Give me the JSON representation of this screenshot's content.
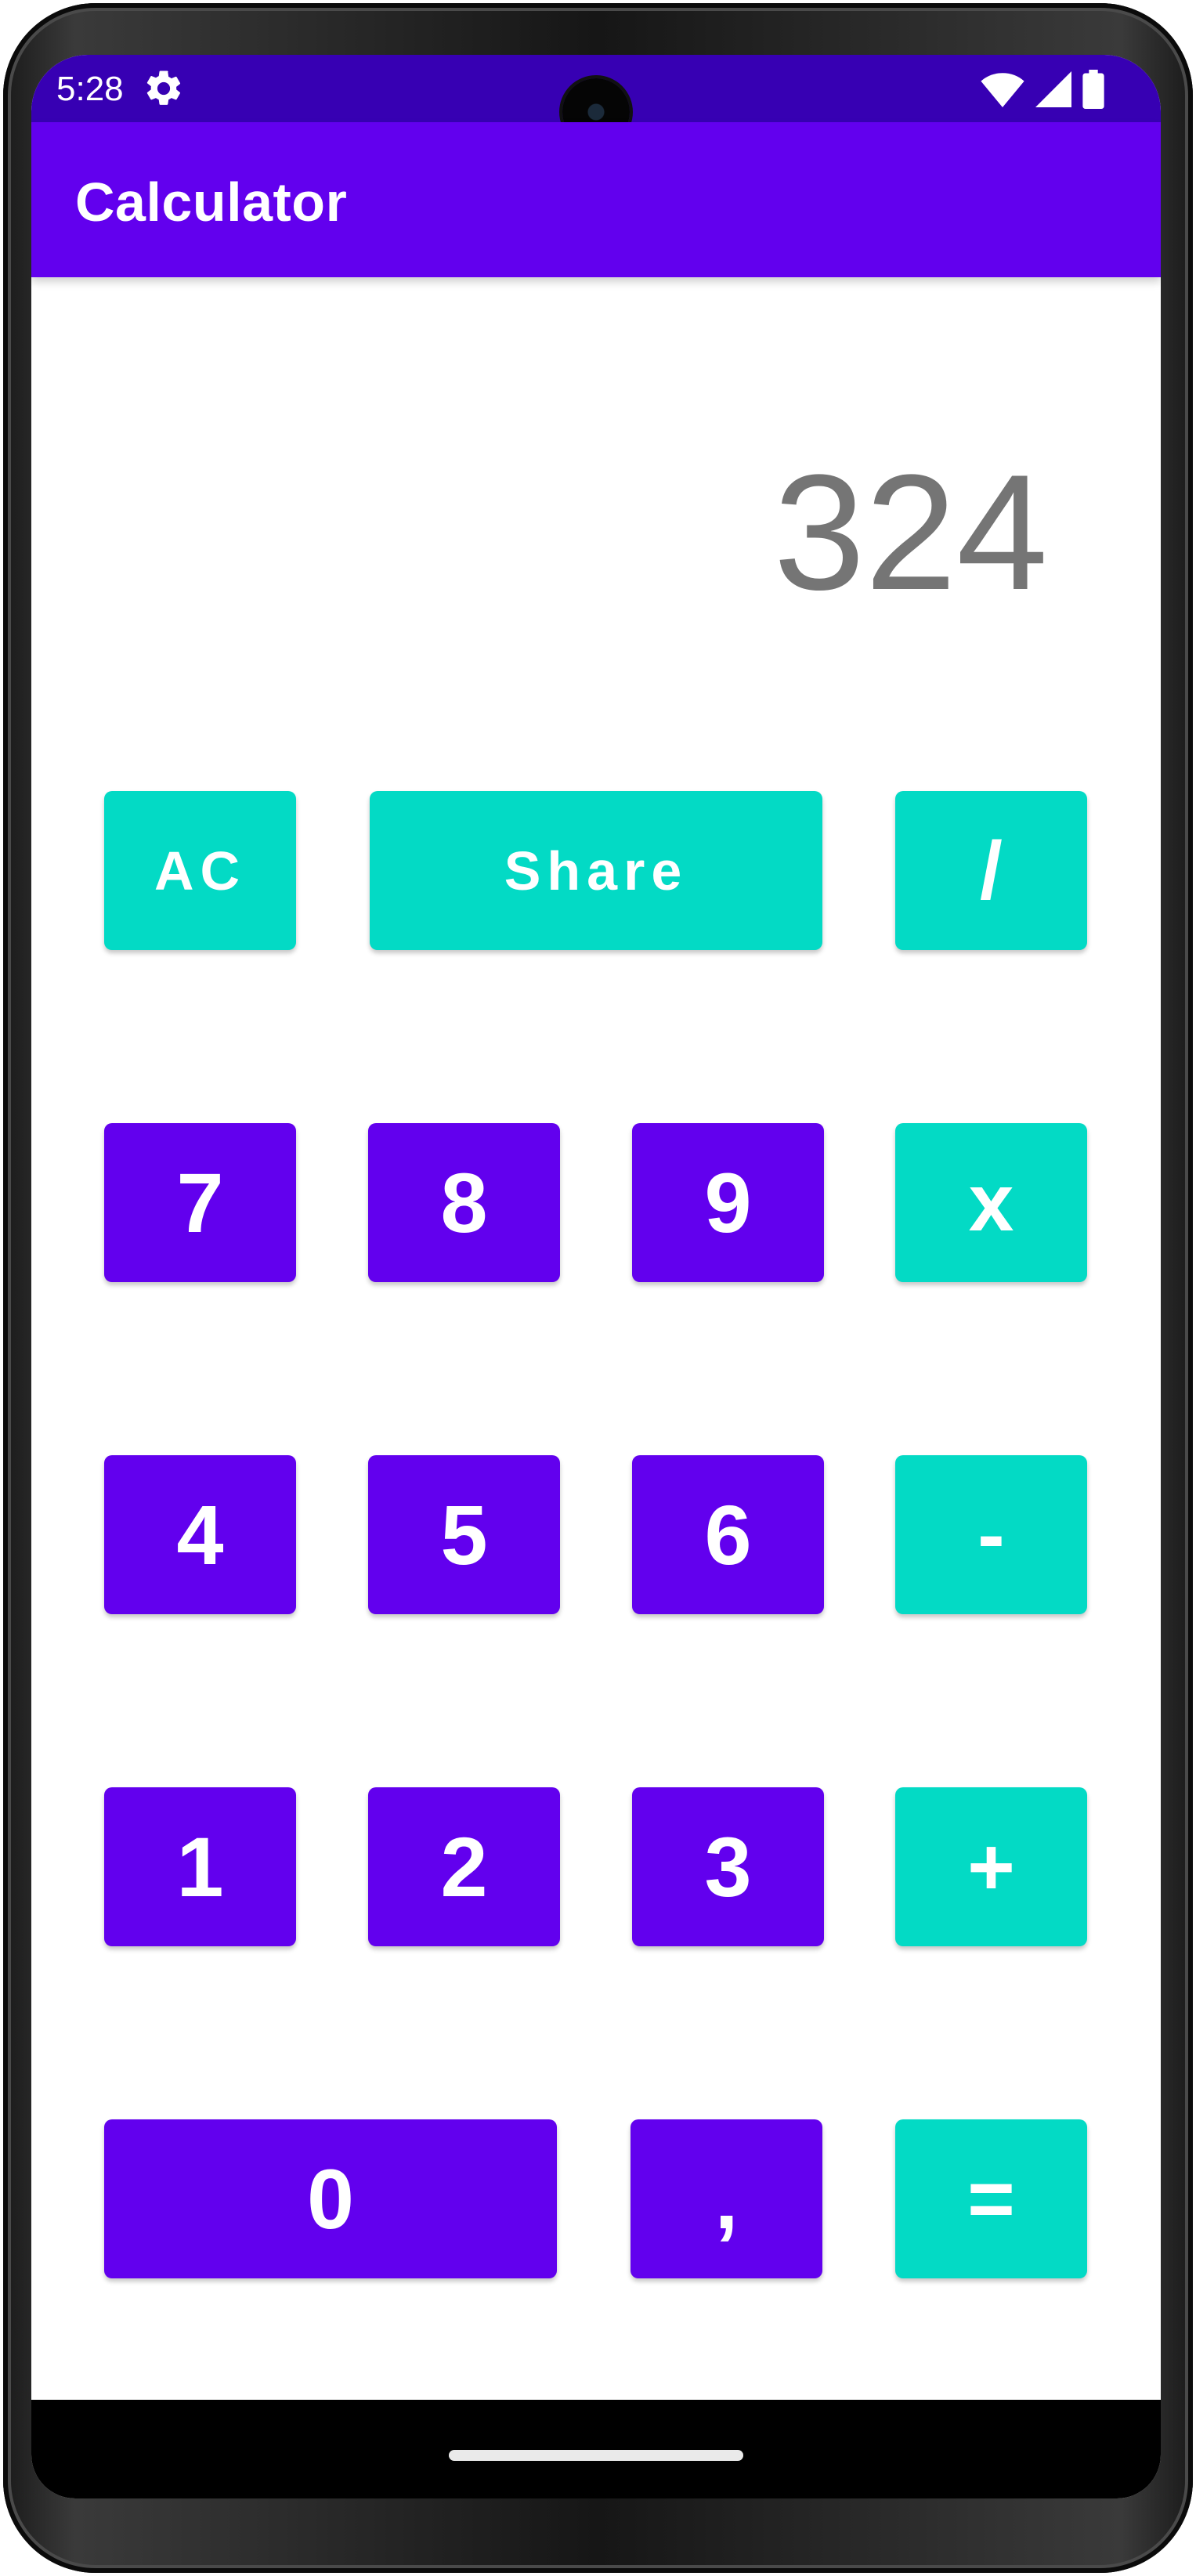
{
  "colors": {
    "status_bar": "#3700b3",
    "app_bar": "#6200ee",
    "primary_button": "#6200ee",
    "accent_button": "#03dac5",
    "display_text": "#757575",
    "button_text": "#ffffff"
  },
  "status_bar": {
    "time": "5:28",
    "left_icon": "gear-icon",
    "right_icons": [
      "wifi-icon",
      "cellular-signal-icon",
      "battery-icon"
    ]
  },
  "app_bar": {
    "title": "Calculator"
  },
  "display": {
    "value": "324"
  },
  "buttons": {
    "ac": "AC",
    "share": "Share",
    "divide": "/",
    "seven": "7",
    "eight": "8",
    "nine": "9",
    "multiply": "x",
    "four": "4",
    "five": "5",
    "six": "6",
    "minus": "-",
    "one": "1",
    "two": "2",
    "three": "3",
    "plus": "+",
    "zero": "0",
    "comma": ",",
    "equals": "="
  }
}
